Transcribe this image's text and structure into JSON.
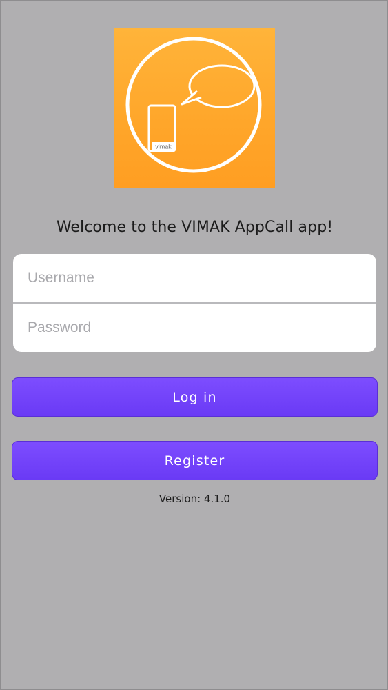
{
  "logo": {
    "phone_label": "vimak",
    "background_color": "#ffa62a"
  },
  "welcome_text": "Welcome to the VIMAK AppCall app!",
  "form": {
    "username_placeholder": "Username",
    "username_value": "",
    "password_placeholder": "Password",
    "password_value": ""
  },
  "buttons": {
    "login_label": "Log in",
    "register_label": "Register",
    "accent_color": "#7448ff"
  },
  "version_text": "Version: 4.1.0"
}
